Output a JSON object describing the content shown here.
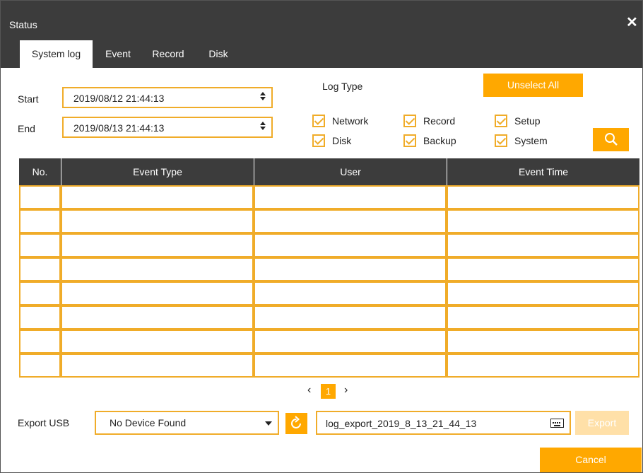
{
  "window": {
    "title": "Status",
    "close_symbol": "✕"
  },
  "tabs": [
    {
      "label": "System log",
      "active": true
    },
    {
      "label": "Event",
      "active": false
    },
    {
      "label": "Record",
      "active": false
    },
    {
      "label": "Disk",
      "active": false
    }
  ],
  "filter": {
    "start_label": "Start",
    "start_value": "2019/08/12 21:44:13",
    "end_label": "End",
    "end_value": "2019/08/13 21:44:13",
    "log_type_label": "Log Type",
    "unselect_all_label": "Unselect All",
    "checkboxes": [
      {
        "label": "Network",
        "checked": true
      },
      {
        "label": "Record",
        "checked": true
      },
      {
        "label": "Setup",
        "checked": true
      },
      {
        "label": "Disk",
        "checked": true
      },
      {
        "label": "Backup",
        "checked": true
      },
      {
        "label": "System",
        "checked": true
      }
    ]
  },
  "table": {
    "columns": [
      "No.",
      "Event Type",
      "User",
      "Event Time"
    ],
    "rows": [
      [
        "",
        "",
        "",
        ""
      ],
      [
        "",
        "",
        "",
        ""
      ],
      [
        "",
        "",
        "",
        ""
      ],
      [
        "",
        "",
        "",
        ""
      ],
      [
        "",
        "",
        "",
        ""
      ],
      [
        "",
        "",
        "",
        ""
      ],
      [
        "",
        "",
        "",
        ""
      ],
      [
        "",
        "",
        "",
        ""
      ]
    ]
  },
  "pagination": {
    "prev": "‹",
    "current_page": "1",
    "next": "›"
  },
  "export": {
    "label": "Export USB",
    "device_value": "No Device Found",
    "filename": "log_export_2019_8_13_21_44_13",
    "export_label": "Export",
    "cancel_label": "Cancel"
  },
  "colors": {
    "accent": "#ffa800",
    "border": "#f0ac29",
    "header": "#3c3c3c",
    "disabled": "#ffe0a8"
  },
  "icons": {
    "search": "search-icon",
    "refresh": "refresh-icon",
    "keyboard": "keyboard-icon",
    "dropdown": "chevron-down-icon",
    "close": "close-icon"
  }
}
